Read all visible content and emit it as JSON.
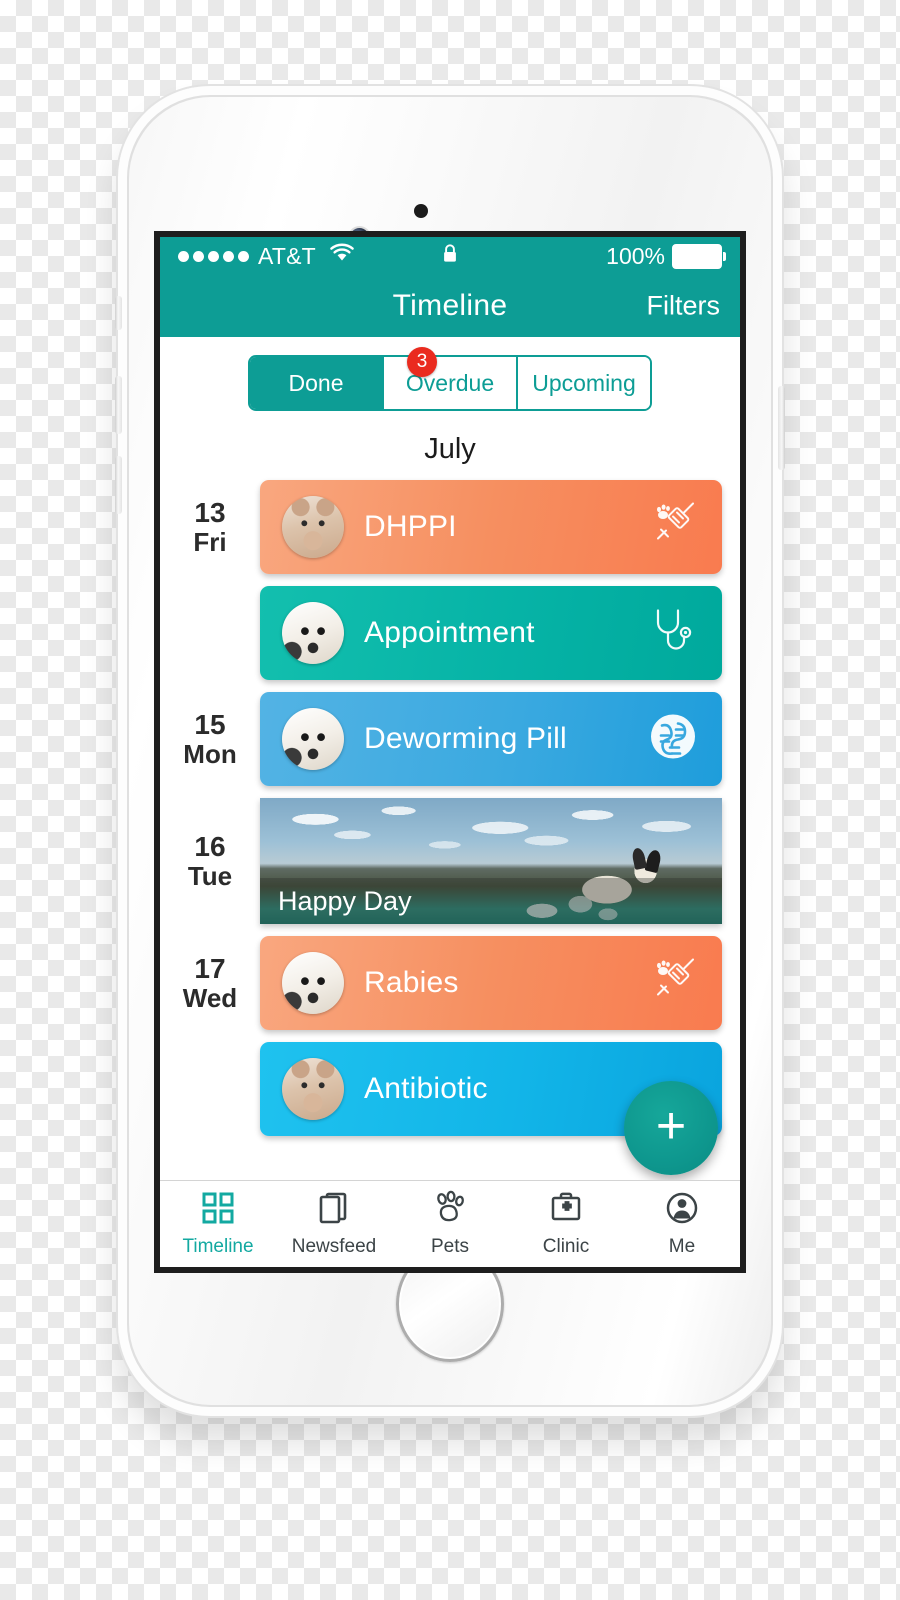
{
  "status_bar": {
    "carrier": "AT&T",
    "signal_dots": 5,
    "wifi_icon": "wifi-icon",
    "lock_icon": "lock-icon",
    "battery_percent": "100%",
    "battery_icon": "battery-full-icon"
  },
  "nav": {
    "title": "Timeline",
    "right_action": "Filters"
  },
  "segmented": {
    "items": [
      {
        "label": "Done",
        "active": true
      },
      {
        "label": "Overdue",
        "active": false
      },
      {
        "label": "Upcoming",
        "active": false
      }
    ],
    "badge": "3",
    "badge_color": "#ea2b1f",
    "accent_color": "#0d9d95"
  },
  "month_header": "July",
  "timeline": [
    {
      "date_num": "13",
      "date_day": "Fri",
      "type": "card",
      "title": "DHPPI",
      "color": "orange",
      "avatar": "cat",
      "icon": "syringe-paw-icon"
    },
    {
      "date_num": "",
      "date_day": "",
      "type": "card",
      "title": "Appointment",
      "color": "teal",
      "avatar": "dog",
      "icon": "stethoscope-icon"
    },
    {
      "date_num": "15",
      "date_day": "Mon",
      "type": "card",
      "title": "Deworming Pill",
      "color": "blue",
      "avatar": "dog",
      "icon": "worm-pill-icon"
    },
    {
      "date_num": "16",
      "date_day": "Tue",
      "type": "photo",
      "title": "Happy Day",
      "color": "photo",
      "avatar": "",
      "icon": ""
    },
    {
      "date_num": "17",
      "date_day": "Wed",
      "type": "card",
      "title": "Rabies",
      "color": "orange",
      "avatar": "dog",
      "icon": "syringe-paw-icon"
    },
    {
      "date_num": "",
      "date_day": "",
      "type": "card",
      "title": "Antibiotic",
      "color": "cyan",
      "avatar": "cat",
      "icon": ""
    }
  ],
  "fab": {
    "icon": "plus-icon",
    "label": "+",
    "color": "#0e978e"
  },
  "tabbar": {
    "items": [
      {
        "label": "Timeline",
        "icon": "grid-icon",
        "active": true
      },
      {
        "label": "Newsfeed",
        "icon": "cards-icon",
        "active": false
      },
      {
        "label": "Pets",
        "icon": "paw-icon",
        "active": false
      },
      {
        "label": "Clinic",
        "icon": "medical-bag-icon",
        "active": false
      },
      {
        "label": "Me",
        "icon": "person-circle-icon",
        "active": false
      }
    ],
    "active_color": "#13a9a1",
    "inactive_color": "#3c4447"
  }
}
